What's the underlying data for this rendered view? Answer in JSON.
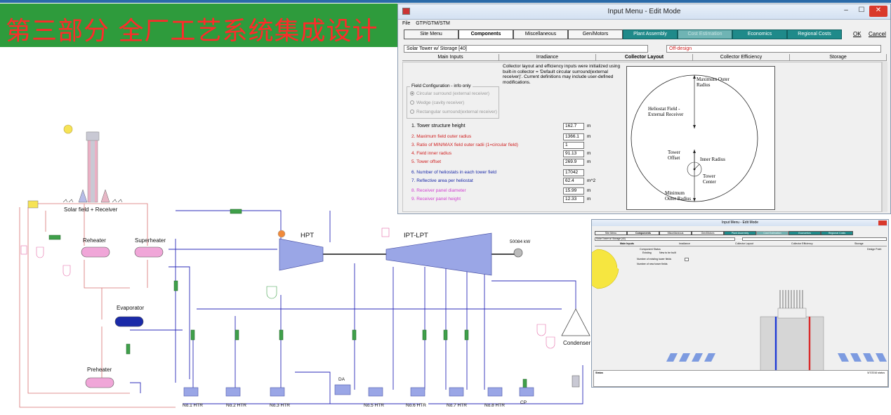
{
  "slide": {
    "title": "第三部分 全厂工艺系统集成设计"
  },
  "main_window": {
    "title": "Input Menu - Edit Mode",
    "menu": [
      "File",
      "GTP/GTM/STM"
    ],
    "nav_tabs": [
      {
        "label": "Site Menu"
      },
      {
        "label": "Components"
      },
      {
        "label": "Miscellaneous"
      },
      {
        "label": "Gen/Motors"
      },
      {
        "label": "Plant Assembly"
      },
      {
        "label": "Cost Estimation"
      },
      {
        "label": "Economics"
      },
      {
        "label": "Regional Costs"
      }
    ],
    "ok_label": "OK",
    "cancel_label": "Cancel",
    "component_select": "Solar Tower w/ Storage [40]",
    "mode_select": "Off-design",
    "sub_tabs": [
      "Main Inputs",
      "Irradiance",
      "Collector Layout",
      "Collector Efficiency",
      "Storage"
    ],
    "note": "Collector layout and efficiency inputs were initialized using built-in collector = 'Default circular surround(external receiver)'. Current definitions may include user-defined modifications.",
    "field_config": {
      "legend": "Field Configuration - info only",
      "options": [
        "Circular surround (external receiver)",
        "Wedge (cavity receiver)",
        "Rectangular surround(external receiver)"
      ]
    },
    "params": [
      {
        "label": "1. Tower structure height",
        "value": "162.7",
        "unit": "m"
      },
      {
        "label": "2. Maximum field outer radius",
        "value": "1366.1",
        "unit": "m"
      },
      {
        "label": "3. Ratio of MIN/MAX field outer radii (1=circular field)",
        "value": "1",
        "unit": ""
      },
      {
        "label": "4. Field inner radius",
        "value": "91.13",
        "unit": "m"
      },
      {
        "label": "5. Tower offset",
        "value": "269.9",
        "unit": "m"
      },
      {
        "label": "6. Number of heliostats in each tower field",
        "value": "17042",
        "unit": ""
      },
      {
        "label": "7. Reflective area per heliostat",
        "value": "62.4",
        "unit": "m^2"
      },
      {
        "label": "8. Receiver panel diameter",
        "value": "15.99",
        "unit": "m"
      },
      {
        "label": "9. Receiver panel height",
        "value": "12.33",
        "unit": "m"
      }
    ],
    "diagram": {
      "max_radius": "Maximum Outer Radius",
      "field_label": "Heliostat Field - External Receiver",
      "tower_offset": "Tower Offset",
      "inner_radius": "Inner Radius",
      "tower_center": "Tower Center",
      "min_radius": "Minimum Outer Radius"
    }
  },
  "flow": {
    "solar_field": "Solar field + Receiver",
    "reheater": "Reheater",
    "superheater": "Superheater",
    "evaporator": "Evaporator",
    "preheater": "Preheater",
    "hpt": "HPT",
    "ipt_lpt": "IPT-LPT",
    "generator_output": "50084 kW",
    "condenser": "Condenser",
    "da": "DA",
    "cp": "CP",
    "heaters": [
      "No.1 HTR",
      "No.2 HTR",
      "No.3 HTR",
      "No.5 HTR",
      "No.6 HTR",
      "No.7 HTR",
      "No.8 HTR"
    ]
  },
  "inset_window": {
    "title": "Input Menu - Edit Mode",
    "nav_tabs": [
      "Site Menu",
      "Components",
      "Miscellaneous",
      "Gen/Motors",
      "Plant Assembly",
      "Cost Estimation",
      "Economics",
      "Regional Costs"
    ],
    "sub_tabs": [
      "Main Inputs",
      "Irradiance",
      "Collector Layout",
      "Collector Efficiency",
      "Storage"
    ],
    "component_select": "Solar Tower w/ Storage [40]",
    "component_status": "Component Status",
    "existing": "Existing",
    "new_to_be_built": "New to be built",
    "tower_fields_label": "Number of existing tower fields",
    "tower_new_label": "Number of new tower fields",
    "design_point": "Design Point",
    "status_label": "Status",
    "date": "5/7/2016 status"
  },
  "colors": {
    "banner": "#2e9b3c",
    "title_text": "#ff2a2a",
    "turbine": "#9aa6e6",
    "hx": "#f0a6d8",
    "pipe_steam": "#2b2bb8",
    "pipe_salt": "#d77070",
    "teal_tab": "#1f8a8a"
  }
}
